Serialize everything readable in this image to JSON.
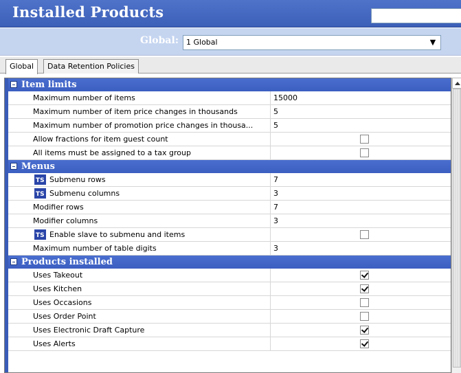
{
  "header": {
    "title": "Installed Products",
    "search_value": ""
  },
  "global": {
    "label": "Global:",
    "selected": "1 Global"
  },
  "tabs": [
    {
      "label": "Global",
      "active": true
    },
    {
      "label": "Data Retention Policies",
      "active": false
    }
  ],
  "sections": [
    {
      "title": "Item limits",
      "rows": [
        {
          "label": "Maximum number of items",
          "value": "15000",
          "icon": false
        },
        {
          "label": "Maximum number of item price changes in thousands",
          "value": "5",
          "icon": false
        },
        {
          "label": "Maximum number of promotion price changes in thousa...",
          "value": "5",
          "icon": false
        },
        {
          "label": "Allow fractions for item guest count",
          "checkbox": true,
          "checked": false,
          "icon": false
        },
        {
          "label": "All items must be assigned to a tax group",
          "checkbox": true,
          "checked": false,
          "icon": false
        }
      ]
    },
    {
      "title": "Menus",
      "rows": [
        {
          "label": "Submenu rows",
          "value": "7",
          "icon": true
        },
        {
          "label": "Submenu columns",
          "value": "3",
          "icon": true
        },
        {
          "label": "Modifier rows",
          "value": "7",
          "icon": false
        },
        {
          "label": "Modifier columns",
          "value": "3",
          "icon": false
        },
        {
          "label": "Enable slave to submenu and items",
          "checkbox": true,
          "checked": false,
          "icon": true
        },
        {
          "label": "Maximum number of table digits",
          "value": "3",
          "icon": false
        }
      ]
    },
    {
      "title": "Products installed",
      "rows": [
        {
          "label": "Uses Takeout",
          "checkbox": true,
          "checked": true,
          "icon": false
        },
        {
          "label": "Uses Kitchen",
          "checkbox": true,
          "checked": true,
          "icon": false
        },
        {
          "label": "Uses Occasions",
          "checkbox": true,
          "checked": false,
          "icon": false
        },
        {
          "label": "Uses Order Point",
          "checkbox": true,
          "checked": false,
          "icon": false
        },
        {
          "label": "Uses Electronic Draft Capture",
          "checkbox": true,
          "checked": true,
          "icon": false
        },
        {
          "label": "Uses Alerts",
          "checkbox": true,
          "checked": true,
          "icon": false
        }
      ]
    }
  ],
  "icon_names": {
    "ts": "ts-store-icon",
    "toggle": "collapse-minus-icon"
  },
  "colors": {
    "header": "#3c5fb8",
    "section": "#3b5ec1",
    "global_bar": "#c5d5f0"
  }
}
